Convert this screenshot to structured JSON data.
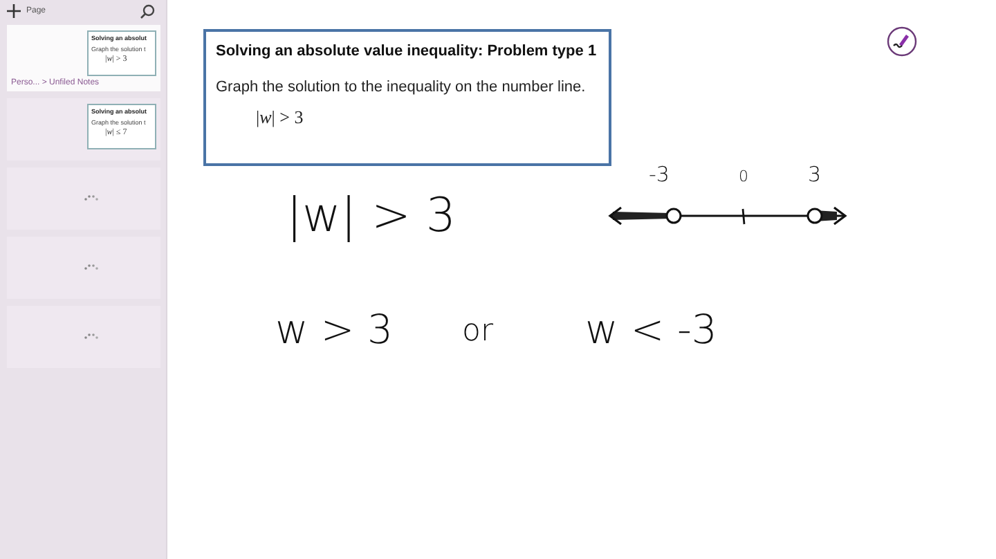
{
  "sidebar": {
    "add_page": "Page",
    "pages": [
      {
        "kind": "thumbnail",
        "selected": true,
        "breadcrumb": "Perso... > Unfiled Notes",
        "thumbnail": {
          "title": "Solving an absolut",
          "line": "Graph the solution t",
          "math": "|*w*| > 3"
        }
      },
      {
        "kind": "thumbnail",
        "selected": false,
        "thumbnail": {
          "title": "Solving an absolut",
          "line": "Graph the solution t",
          "math": "|*w*| ≤ 7"
        }
      },
      {
        "kind": "loading",
        "selected": false
      },
      {
        "kind": "loading",
        "selected": false
      },
      {
        "kind": "loading",
        "selected": false
      }
    ]
  },
  "problem": {
    "title": "Solving an absolute value inequality: Problem type 1",
    "instruction": "Graph the solution to the inequality on the number line.",
    "math": "|*w*| > 3"
  },
  "ink": {
    "equation": "|w| > 3",
    "number_line_labels": [
      "-3",
      "0",
      "3"
    ],
    "left_answer": "w > 3",
    "connector": "or",
    "right_answer": "w < -3"
  }
}
